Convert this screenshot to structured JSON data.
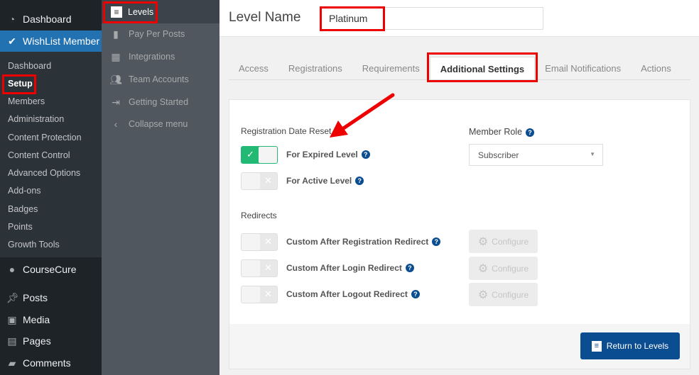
{
  "sidebar": {
    "dashboard": "Dashboard",
    "wishlist": "WishList Member",
    "sub": [
      "Dashboard",
      "Setup",
      "Members",
      "Administration",
      "Content Protection",
      "Content Control",
      "Advanced Options",
      "Add-ons",
      "Badges",
      "Points",
      "Growth Tools"
    ],
    "coursecure": "CourseCure",
    "posts": "Posts",
    "media": "Media",
    "pages": "Pages",
    "comments": "Comments"
  },
  "submenu": {
    "levels": "Levels",
    "pay_per_posts": "Pay Per Posts",
    "integrations": "Integrations",
    "team_accounts": "Team Accounts",
    "getting_started": "Getting Started",
    "collapse": "Collapse menu"
  },
  "header": {
    "level_name_label": "Level Name",
    "level_name_value": "Platinum"
  },
  "tabs": [
    "Access",
    "Registrations",
    "Requirements",
    "Additional Settings",
    "Email Notifications",
    "Actions"
  ],
  "panel": {
    "reg_reset_title": "Registration Date Reset",
    "expired": "For Expired Level",
    "active": "For Active Level",
    "member_role_label": "Member Role",
    "member_role_value": "Subscriber",
    "redirects_title": "Redirects",
    "redirects": [
      "Custom After Registration Redirect",
      "Custom After Login Redirect",
      "Custom After Logout Redirect"
    ],
    "configure": "Configure",
    "return": "Return to Levels",
    "help": "?"
  },
  "toggles": {
    "expired": true,
    "active": false,
    "registration": false,
    "login": false,
    "logout": false
  },
  "colors": {
    "accent": "#2271b1",
    "toggle_on": "#21b973",
    "button": "#0b4d91",
    "annotation": "#e00000"
  }
}
